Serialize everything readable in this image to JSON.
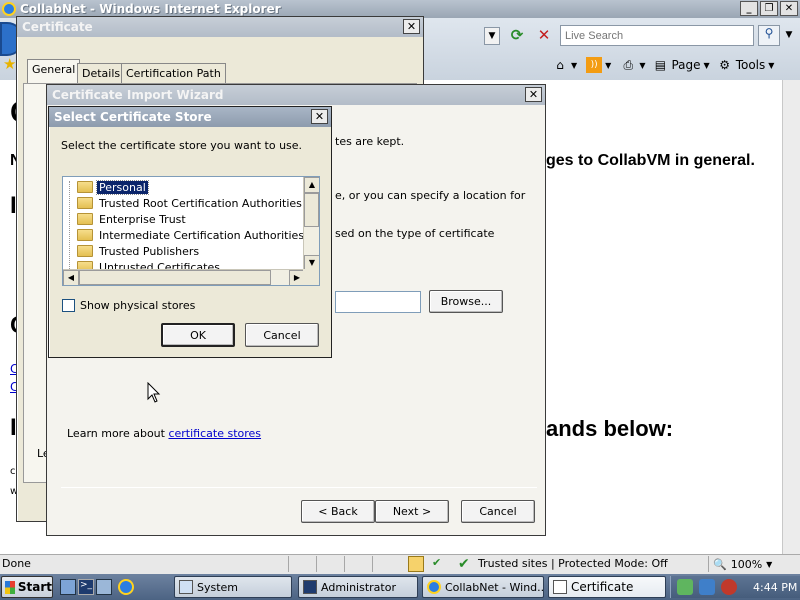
{
  "browser": {
    "title": "CollabNet - Windows Internet Explorer",
    "search_placeholder": "Live Search",
    "commands": {
      "page": "Page",
      "tools": "Tools"
    },
    "status": {
      "left": "Done",
      "zone": "Trusted sites | Protected Mode: Off",
      "zoom": "100%"
    }
  },
  "page_fragments": {
    "line1": "ges to CollabVM in general.",
    "line2": "ands below:",
    "link1": "C",
    "link2": "C",
    "letter_c1": "C",
    "letter_c2": "C",
    "letter_n": "N",
    "letter_l": "I",
    "letter_l2": "I",
    "small1": "c",
    "small2": "w"
  },
  "certificate_dialog": {
    "title": "Certificate",
    "tabs": [
      "General",
      "Details",
      "Certification Path"
    ],
    "fragment": "Le"
  },
  "import_wizard": {
    "title": "Certificate Import Wizard",
    "text1": "tes are kept.",
    "text2": "e, or you can specify a location for",
    "text3": "sed on the type of certificate",
    "browse_label": "Browse...",
    "learn_more_text": "Learn more about ",
    "learn_more_link": "certificate stores",
    "back_label": "< Back",
    "next_label": "Next >",
    "cancel_label": "Cancel"
  },
  "select_store": {
    "title": "Select Certificate Store",
    "prompt": "Select the certificate store you want to use.",
    "stores": [
      "Personal",
      "Trusted Root Certification Authorities",
      "Enterprise Trust",
      "Intermediate Certification Authorities",
      "Trusted Publishers",
      "Untrusted Certificates"
    ],
    "selected_index": 0,
    "show_physical_label": "Show physical stores",
    "show_physical_checked": false,
    "ok_label": "OK",
    "cancel_label": "Cancel"
  },
  "taskbar": {
    "start_label": "Start",
    "tasks": [
      "System",
      "Administrator",
      "CollabNet - Wind...",
      "Certificate"
    ],
    "active_task": "Certificate",
    "clock": "4:44 PM"
  }
}
